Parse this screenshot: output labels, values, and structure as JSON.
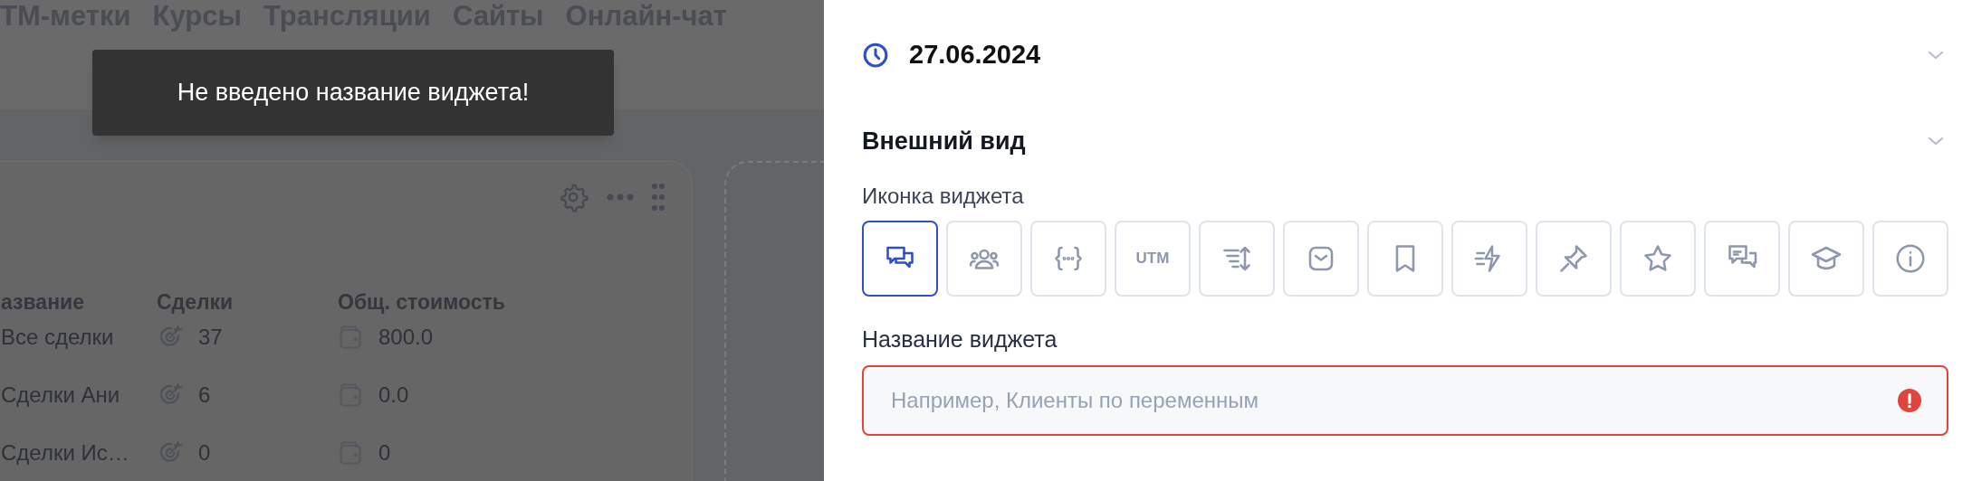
{
  "nav": [
    "ТМ-метки",
    "Курсы",
    "Трансляции",
    "Сайты",
    "Онлайн-чат"
  ],
  "toast": {
    "message": "Не введено название виджета!"
  },
  "widget_card": {
    "columns": [
      "азвание",
      "Сделки",
      "Общ. стоимость"
    ],
    "rows": [
      {
        "name": "Все сделки",
        "deals": "37",
        "cost": "800.0"
      },
      {
        "name": "Сделки Ани",
        "deals": "6",
        "cost": "0.0"
      },
      {
        "name": "Сделки Ис…",
        "deals": "0",
        "cost": "0"
      }
    ]
  },
  "panel": {
    "date": "27.06.2024",
    "appearance": {
      "title": "Внешний вид",
      "icon_label": "Иконка виджета",
      "icons": [
        {
          "kind": "chat",
          "selected": true
        },
        {
          "kind": "users",
          "selected": false
        },
        {
          "kind": "braces",
          "selected": false
        },
        {
          "kind": "text",
          "label": "UTM",
          "selected": false
        },
        {
          "kind": "sort",
          "selected": false
        },
        {
          "kind": "mail",
          "selected": false
        },
        {
          "kind": "bookmark",
          "selected": false
        },
        {
          "kind": "bolt",
          "selected": false
        },
        {
          "kind": "pin",
          "selected": false
        },
        {
          "kind": "star",
          "selected": false
        },
        {
          "kind": "chat-dots",
          "selected": false
        },
        {
          "kind": "cap",
          "selected": false
        },
        {
          "kind": "info",
          "selected": false
        }
      ],
      "name_label": "Название виджета",
      "name_field": {
        "placeholder": "Например, Клиенты по переменным",
        "error": true
      }
    }
  }
}
